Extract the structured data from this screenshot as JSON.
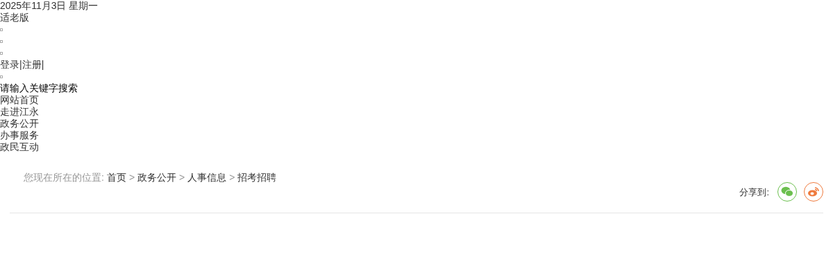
{
  "date": "2025年11月3日 星期一",
  "elder_mode": "适老版",
  "auth": {
    "login": "登录",
    "separator_1": "|",
    "register": "注册",
    "separator_2": "|"
  },
  "search": {
    "text": "请输入关键字搜索"
  },
  "nav": [
    "网站首页",
    "走进江永",
    "政务公开",
    "办事服务",
    "政民互动"
  ],
  "breadcrumb": {
    "label": "您现在所在的位置:",
    "items": [
      {
        "text": "首页",
        "separator": ">"
      },
      {
        "text": "政务公开",
        "separator": ">"
      },
      {
        "text": "人事信息",
        "separator": ">"
      },
      {
        "text": "招考招聘"
      }
    ]
  },
  "share": {
    "label": "分享到:"
  }
}
